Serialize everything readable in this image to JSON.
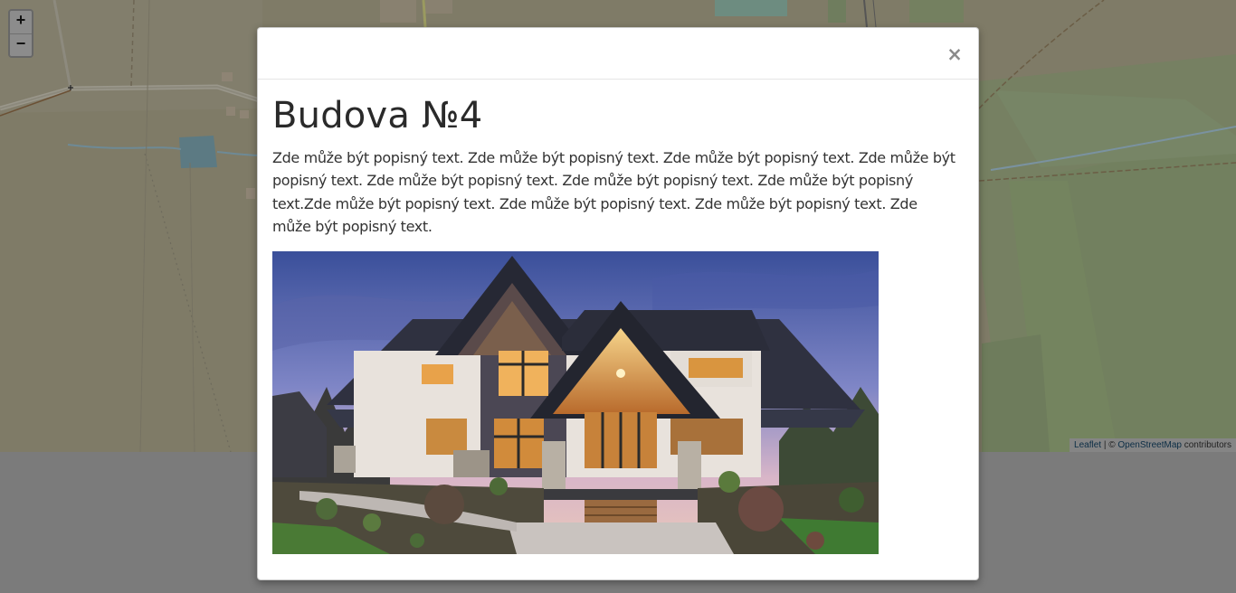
{
  "map": {
    "zoom_in_label": "+",
    "zoom_out_label": "−",
    "attribution": {
      "leaflet": "Leaflet",
      "separator": " | © ",
      "osm": "OpenStreetMap",
      "suffix": " contributors"
    }
  },
  "modal": {
    "close_label": "×",
    "title": "Budova №4",
    "text": "Zde může být popisný text. Zde může být popisný text. Zde může být popisný text. Zde může být popisný text. Zde může být popisný text. Zde může být popisný text. Zde může být popisný text.Zde může být popisný text. Zde může být popisný text. Zde může být popisný text. Zde může být popisný text.",
    "image": "house-photo"
  }
}
